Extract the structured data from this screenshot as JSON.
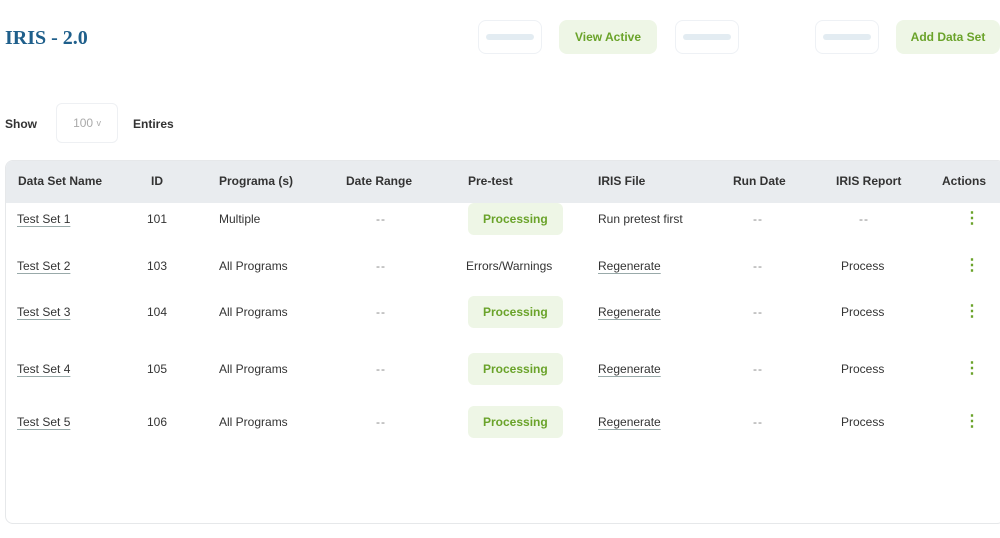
{
  "header": {
    "title": "IRIS - 2.0",
    "view_active": "View Active",
    "add_data_set": "Add Data Set"
  },
  "entries": {
    "show": "Show",
    "value": "100",
    "chevron": "v",
    "suffix": "Entires"
  },
  "table": {
    "columns": [
      "Data Set Name",
      "ID",
      "Programa (s)",
      "Date Range",
      "Pre-test",
      "IRIS File",
      "Run Date",
      "IRIS Report",
      "Actions"
    ],
    "rows": [
      {
        "name": "Test Set 1",
        "id": "101",
        "programs": "Multiple",
        "date_range": "--",
        "pretest": "Processing",
        "pretest_badge": true,
        "iris_file": "Run pretest first",
        "file_link": false,
        "run_date": "--",
        "report": "--",
        "actions": "⋮"
      },
      {
        "name": "Test Set 2",
        "id": "103",
        "programs": "All Programs",
        "date_range": "--",
        "pretest": "Errors/Warnings",
        "pretest_badge": false,
        "iris_file": "Regenerate",
        "file_link": true,
        "run_date": "--",
        "report": "Process",
        "actions": "⋮"
      },
      {
        "name": "Test Set 3",
        "id": "104",
        "programs": "All Programs",
        "date_range": "--",
        "pretest": "Processing",
        "pretest_badge": true,
        "iris_file": "Regenerate",
        "file_link": true,
        "run_date": "--",
        "report": "Process",
        "actions": "⋮"
      },
      {
        "name": "Test Set 4",
        "id": "105",
        "programs": "All Programs",
        "date_range": "--",
        "pretest": "Processing",
        "pretest_badge": true,
        "iris_file": "Regenerate",
        "file_link": true,
        "run_date": "--",
        "report": "Process",
        "actions": "⋮"
      },
      {
        "name": "Test Set 5",
        "id": "106",
        "programs": "All Programs",
        "date_range": "--",
        "pretest": "Processing",
        "pretest_badge": true,
        "iris_file": "Regenerate",
        "file_link": true,
        "run_date": "--",
        "report": "Process",
        "actions": "⋮"
      }
    ]
  }
}
